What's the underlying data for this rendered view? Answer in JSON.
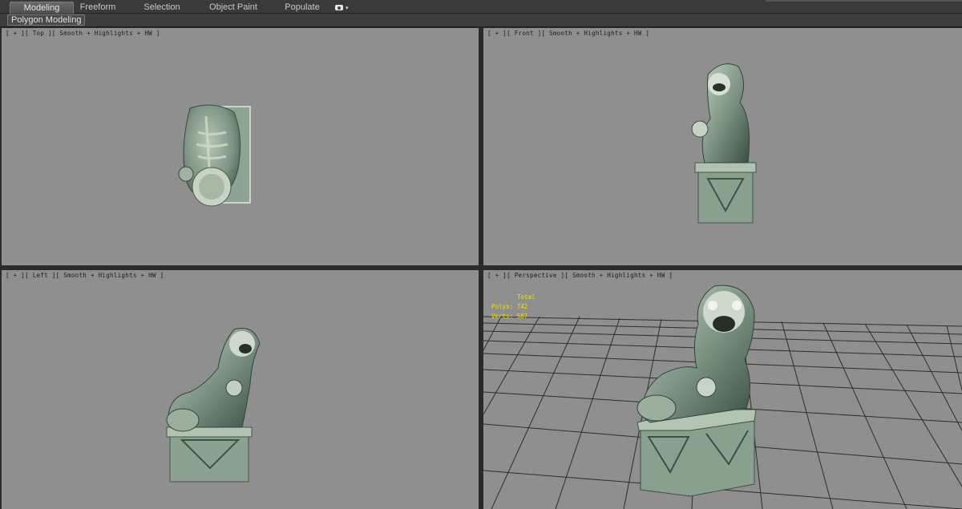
{
  "ribbon": {
    "tabs": [
      {
        "label": "Modeling",
        "active": true
      },
      {
        "label": "Freeform",
        "active": false
      },
      {
        "label": "Selection",
        "active": false
      },
      {
        "label": "Object Paint",
        "active": false
      },
      {
        "label": "Populate",
        "active": false
      }
    ],
    "extra_icon": "camera-icon",
    "extra_dropdown": "▾",
    "panel_label": "Polygon Modeling"
  },
  "viewports": {
    "top": {
      "label": "[ + ][ Top ][ Smooth + Highlights + HW ]"
    },
    "front": {
      "label": "[ + ][ Front ][ Smooth + Highlights + HW ]"
    },
    "left": {
      "label": "[ + ][ Left ][ Smooth + Highlights + HW ]"
    },
    "perspective": {
      "label": "[ + ][ Perspective ][ Smooth + Highlights + HW ]",
      "stats": {
        "total_label": "Total",
        "polys_label": "Polys:",
        "polys_value": "742",
        "verts_label": "Verts:",
        "verts_value": "587"
      }
    }
  },
  "colors": {
    "viewport_bg": "#8f8f8f",
    "stats_text": "#f0e000",
    "model_jade": "#7e9484"
  }
}
